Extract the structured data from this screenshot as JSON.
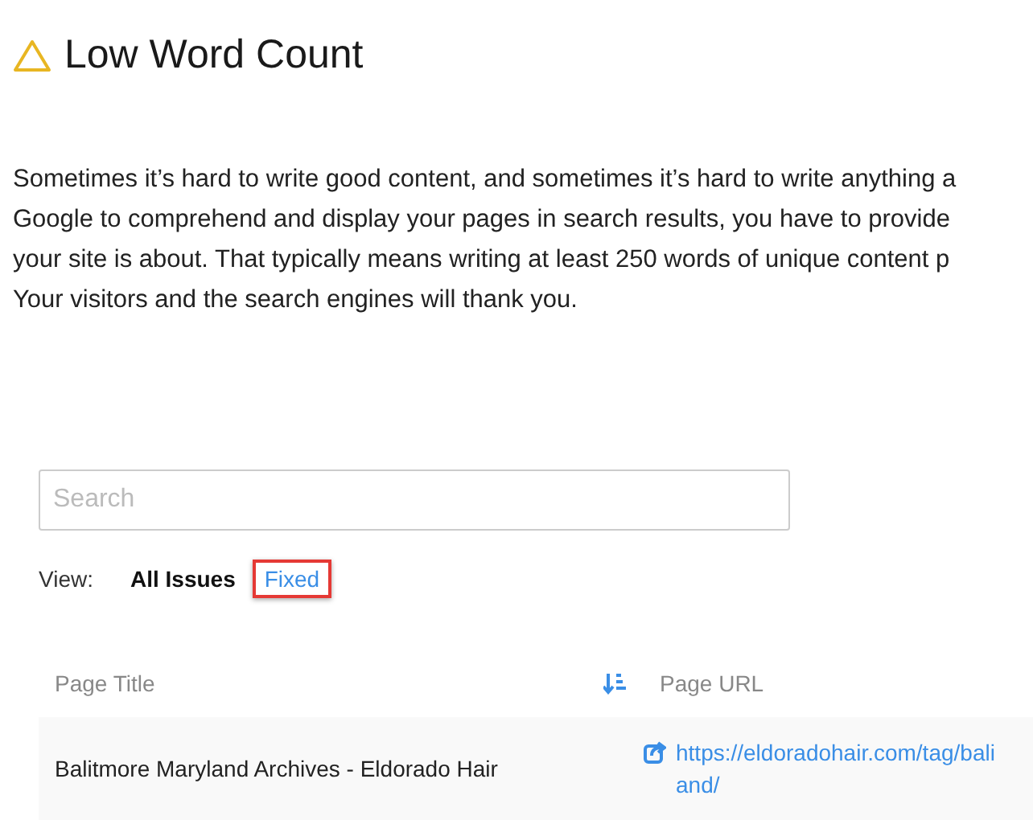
{
  "heading": {
    "title": "Low Word Count"
  },
  "description": {
    "lines": [
      "Sometimes it’s hard to write good content, and sometimes it’s hard to write anything a",
      "Google to comprehend and display your pages in search results, you have to provide",
      "your site is about. That typically means writing at least 250 words of unique content p",
      "Your visitors and the search engines will thank you."
    ]
  },
  "search": {
    "placeholder": "Search"
  },
  "view": {
    "label": "View:",
    "options": [
      {
        "label": "All Issues",
        "selected": true,
        "highlighted": false
      },
      {
        "label": "Fixed",
        "selected": false,
        "highlighted": true
      }
    ]
  },
  "table": {
    "columns": [
      {
        "label": "Page Title",
        "sortable": true
      },
      {
        "label": "Page URL",
        "sortable": false
      }
    ],
    "rows": [
      {
        "title": "Balitmore Maryland Archives - Eldorado Hair",
        "url_lines": [
          "https://eldoradohair.com/tag/bali",
          "and/"
        ]
      }
    ]
  }
}
